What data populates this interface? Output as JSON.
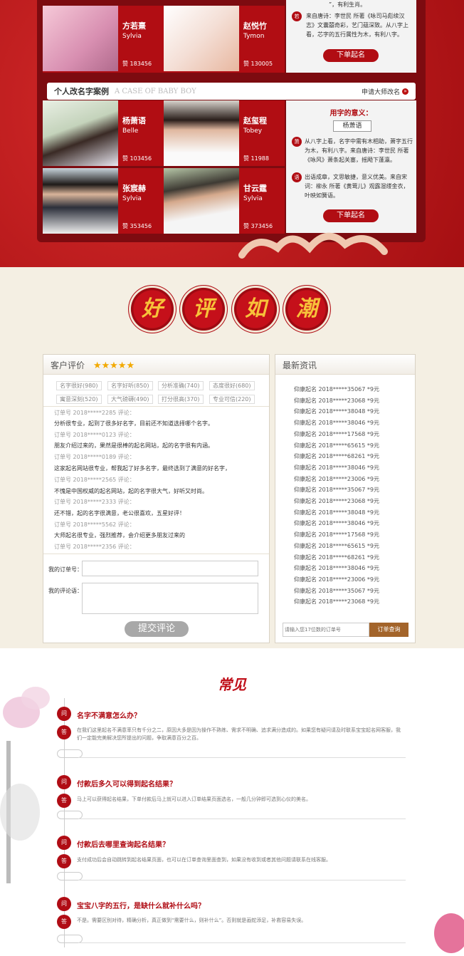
{
  "top_section": {
    "cards_top": [
      {
        "name": "方若熹",
        "en": "Sylvia",
        "zan": "赞 183456"
      },
      {
        "name": "赵悦竹",
        "en": "Tymon",
        "zan": "赞 130005"
      }
    ],
    "top_panel": {
      "line0": "”，有利生肖。",
      "note_icon": "若",
      "note": "来自唐诗：李世民 所著《咏司马彪续汉志》文囊囍奇彩，艺门蕴深致。从八字上看，芯字的五行属性为木，有利八字。",
      "button": "下单起名"
    },
    "section_header": {
      "title": "个人改名字案例",
      "subtitle": "A CASE OF BABY BOY",
      "apply": "申请大师改名",
      "apply_icon": "»"
    },
    "cards": [
      {
        "name": "杨萧语",
        "en": "Belle",
        "zan": "赞 103456"
      },
      {
        "name": "赵玺程",
        "en": "Tobey",
        "zan": "赞 11988"
      },
      {
        "name": "张宸赫",
        "en": "Sylvia",
        "zan": "赞 353456"
      },
      {
        "name": "甘云霆",
        "en": "Sylvia",
        "zan": "赞 373456"
      }
    ],
    "panel": {
      "title": "用字的意义：",
      "name_box": "杨萧语",
      "note1_icon": "萧",
      "note1": "从八字上看，名字中需有木相助，萧字五行为木，有利八字。来自唐诗：李世民 所著《咏风》萧条起关塞，摇飏下蓬瀛。",
      "note2_icon": "语",
      "note2": "出语成章，文思敏捷，意义优美。来自宋词：柳永 所著《黄莺儿》观露湿缕金衣，叶映如簧语。",
      "button": "下单起名"
    }
  },
  "slogan": [
    "好",
    "评",
    "如",
    "潮"
  ],
  "reviews": {
    "title": "客户评价",
    "stars": "★★★★★",
    "tags": [
      "名字很好(980)",
      "名字好听(850)",
      "分析准确(740)",
      "态度很好(680)",
      "寓意深刻(520)",
      "大气磅礴(490)",
      "打分很高(370)",
      "专业可信(220)"
    ],
    "comments": [
      {
        "text": "订单号   2018*****2285 评论：",
        "gray": true
      },
      {
        "text": "分析很专业，起到了很多好名字，目前还不知道选择哪个名字。",
        "gray": false
      },
      {
        "text": "订单号   2018*****0123 评论：",
        "gray": true
      },
      {
        "text": "朋友介绍过来的，果然是很棒的起名网站，起的名字很有内涵。",
        "gray": false
      },
      {
        "text": "订单号   2018*****0189 评论：",
        "gray": true
      },
      {
        "text": "这家起名网站很专业，帮我起了好多名字，最终选到了满意的好名字，",
        "gray": false
      },
      {
        "text": "订单号   2018*****2565 评论：",
        "gray": true
      },
      {
        "text": "不愧是中国权威的起名网站，起的名字很大气，好听又时尚。",
        "gray": false
      },
      {
        "text": "订单号   2018*****2333 评论：",
        "gray": true
      },
      {
        "text": "还不错，起的名字很满意，老公很喜欢，五星好评！",
        "gray": false
      },
      {
        "text": "订单号   2018*****5562 评论：",
        "gray": true
      },
      {
        "text": "大师起名很专业，强烈推荐，会介绍更多朋友过来的",
        "gray": false
      },
      {
        "text": "订单号   2018*****2356 评论：",
        "gray": true
      }
    ],
    "order_label": "我的订单号：",
    "comment_label": "我的评论语：",
    "submit": "提交评论"
  },
  "news": {
    "title": "最新资讯",
    "items": [
      "仰康起名 2018*****35067 *9元",
      "仰康起名 2018*****23068 *9元",
      "仰康起名 2018*****38048 *9元",
      "仰康起名 2018*****38046 *9元",
      "仰康起名 2018*****17568 *9元",
      "仰康起名 2018*****65615 *9元",
      "仰康起名 2018*****68261 *9元",
      "仰康起名 2018*****38046 *9元",
      "仰康起名 2018*****23006 *9元",
      "仰康起名 2018*****35067 *9元",
      "仰康起名 2018*****23068 *9元",
      "仰康起名 2018*****38048 *9元",
      "仰康起名 2018*****38046 *9元",
      "仰康起名 2018*****17568 *9元",
      "仰康起名 2018*****65615 *9元",
      "仰康起名 2018*****68261 *9元",
      "仰康起名 2018*****38046 *9元",
      "仰康起名 2018*****23006 *9元",
      "仰康起名 2018*****35067 *9元",
      "仰康起名 2018*****23068 *9元"
    ],
    "placeholder": "请输入您17位数的订单号",
    "query_button": "订单查询"
  },
  "faq": {
    "title": "常见",
    "q_icon": "问",
    "a_icon": "答",
    "items": [
      {
        "q": "名字不满意怎么办？",
        "a": "在我们这里起名不满意率只有千分之二，原因大多是因为操作不熟练、需求不明确、追求满分造成的。如果您有疑问请及时联系宝宝起名网客服，我们一定能完美解决您所提出的问题，争取满意百分之百。"
      },
      {
        "q": "付款后多久可以得到起名结果？",
        "a": "马上可以获得起名结果，下单付款后马上就可以进入订单结果页面选名，一般几分钟即可选到心仪的美名。"
      },
      {
        "q": "付款后去哪里查询起名结果？",
        "a": "支付成功后会自动跳转到起名结果页面，也可以在订单查询里面查到，如果没有收到或者其他问题请联系在线客服。"
      },
      {
        "q": "宝宝八字的五行，是缺什么就补什么吗？",
        "a": "不是。需要区别对待，精确分析，真正做到“需要什么，则补什么”。否则就是画蛇添足，补救容易失误。"
      }
    ]
  },
  "colors": {
    "brand_red": "#b10d13",
    "dark_red": "#7d0b10",
    "gold": "#f7c23a",
    "beige": "#f4efe3"
  }
}
